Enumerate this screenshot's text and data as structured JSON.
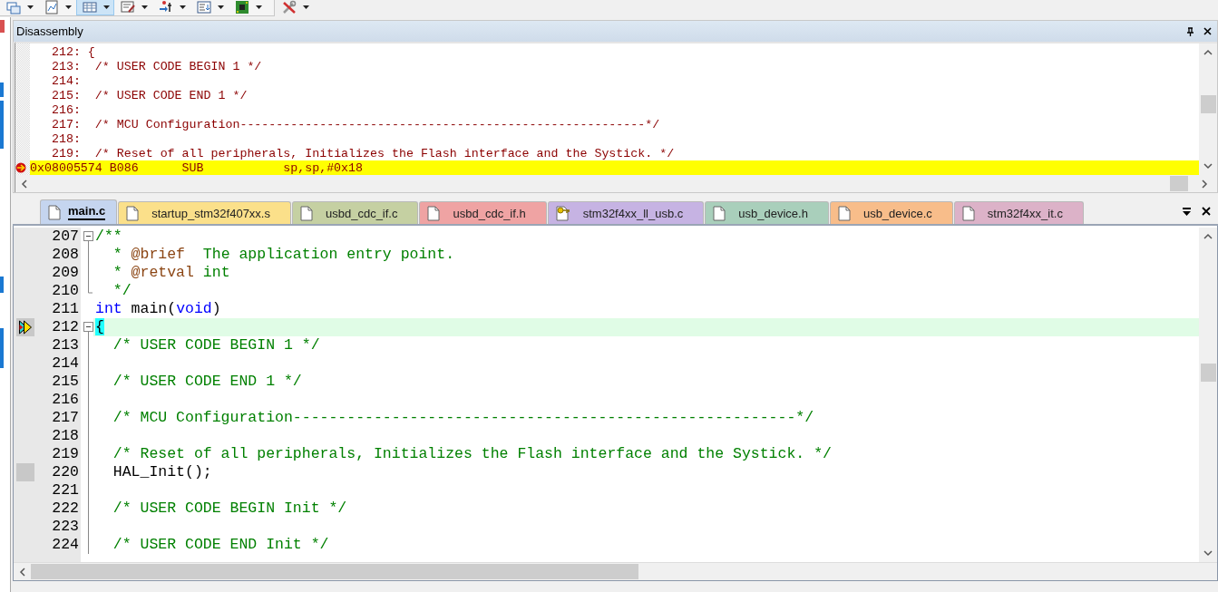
{
  "toolbar": {
    "buttons": [
      {
        "kind": "windows",
        "pressed": false
      },
      {
        "kind": "chart",
        "pressed": false
      },
      {
        "kind": "grid",
        "pressed": true
      },
      {
        "kind": "notes",
        "pressed": false
      },
      {
        "kind": "trace",
        "pressed": false
      },
      {
        "kind": "list",
        "pressed": false
      },
      {
        "kind": "board",
        "pressed": false
      },
      {
        "kind": "tools",
        "pressed": false
      }
    ]
  },
  "disassembly": {
    "title": "Disassembly",
    "source_lines": [
      "212: {",
      "213:  /* USER CODE BEGIN 1 */",
      "214:",
      "215:  /* USER CODE END 1 */",
      "216:",
      "217:  /* MCU Configuration--------------------------------------------------------*/",
      "218:",
      "219:  /* Reset of all peripherals, Initializes the Flash interface and the Systick. */"
    ],
    "instruction": {
      "address": "0x08005574",
      "opcode": "B086",
      "mnemonic": "SUB",
      "operands": "sp,sp,#0x18",
      "current": true
    }
  },
  "tabs": [
    {
      "label": "main.c",
      "kind": "file",
      "color": "#c5d5ef",
      "selected": true
    },
    {
      "label": "startup_stm32f407xx.s",
      "kind": "file",
      "color": "#fbe08a",
      "selected": false
    },
    {
      "label": "usbd_cdc_if.c",
      "kind": "file",
      "color": "#c5d0a2",
      "selected": false
    },
    {
      "label": "usbd_cdc_if.h",
      "kind": "file",
      "color": "#efa3a3",
      "selected": false
    },
    {
      "label": "stm32f4xx_ll_usb.c",
      "kind": "key",
      "color": "#c6b3e3",
      "selected": false
    },
    {
      "label": "usb_device.h",
      "kind": "file",
      "color": "#a9cfbb",
      "selected": false
    },
    {
      "label": "usb_device.c",
      "kind": "file",
      "color": "#f8bd8a",
      "selected": false
    },
    {
      "label": "stm32f4xx_it.c",
      "kind": "file",
      "color": "#dcb2c8",
      "selected": false
    }
  ],
  "editor": {
    "lines": [
      {
        "number": "207",
        "current": false,
        "has_code": false,
        "segments": [
          {
            "kind": "comment",
            "text": "/**"
          }
        ],
        "children": [
          {
            "number": "208",
            "current": false,
            "has_code": false,
            "segments": [
              {
                "kind": "comment",
                "text": "  * "
              },
              {
                "kind": "tag",
                "text": "@brief"
              },
              {
                "kind": "comment",
                "text": "  The application entry point."
              }
            ]
          },
          {
            "number": "209",
            "current": false,
            "has_code": false,
            "segments": [
              {
                "kind": "comment",
                "text": "  * "
              },
              {
                "kind": "tag",
                "text": "@retval"
              },
              {
                "kind": "comment",
                "text": " int"
              }
            ]
          },
          {
            "number": "210",
            "current": false,
            "has_code": false,
            "segments": [
              {
                "kind": "comment",
                "text": "  */"
              }
            ]
          }
        ]
      },
      {
        "number": "211",
        "current": false,
        "has_code": false,
        "segments": [
          {
            "kind": "keyword",
            "text": "int"
          },
          {
            "kind": "plain",
            "text": " main("
          },
          {
            "kind": "keyword",
            "text": "void"
          },
          {
            "kind": "plain",
            "text": ")"
          }
        ]
      },
      {
        "number": "212",
        "current": true,
        "has_code": true,
        "segments": [
          {
            "kind": "brace",
            "text": "{"
          }
        ],
        "children": [
          {
            "number": "213",
            "current": false,
            "has_code": false,
            "segments": [
              {
                "kind": "comment",
                "text": "  /* USER CODE BEGIN 1 */"
              }
            ]
          },
          {
            "number": "214",
            "current": false,
            "has_code": false
          },
          {
            "number": "215",
            "current": false,
            "has_code": false,
            "segments": [
              {
                "kind": "comment",
                "text": "  /* USER CODE END 1 */"
              }
            ]
          },
          {
            "number": "216",
            "current": false,
            "has_code": false
          },
          {
            "number": "217",
            "current": false,
            "has_code": false,
            "segments": [
              {
                "kind": "comment",
                "text": "  /* MCU Configuration--------------------------------------------------------*/"
              }
            ]
          },
          {
            "number": "218",
            "current": false,
            "has_code": false
          },
          {
            "number": "219",
            "current": false,
            "has_code": false,
            "segments": [
              {
                "kind": "comment",
                "text": "  /* Reset of all peripherals, Initializes the Flash interface and the Systick. */"
              }
            ]
          },
          {
            "number": "220",
            "current": false,
            "has_code": true,
            "segments": [
              {
                "kind": "plain",
                "text": "  HAL_Init();"
              }
            ]
          },
          {
            "number": "221",
            "current": false,
            "has_code": false
          },
          {
            "number": "222",
            "current": false,
            "has_code": false,
            "segments": [
              {
                "kind": "comment",
                "text": "  /* USER CODE BEGIN Init */"
              }
            ]
          },
          {
            "number": "223",
            "current": false,
            "has_code": false
          },
          {
            "number": "224",
            "current": false,
            "has_code": false,
            "segments": [
              {
                "kind": "comment",
                "text": "  /* USER CODE END Init */"
              }
            ]
          }
        ]
      }
    ]
  }
}
